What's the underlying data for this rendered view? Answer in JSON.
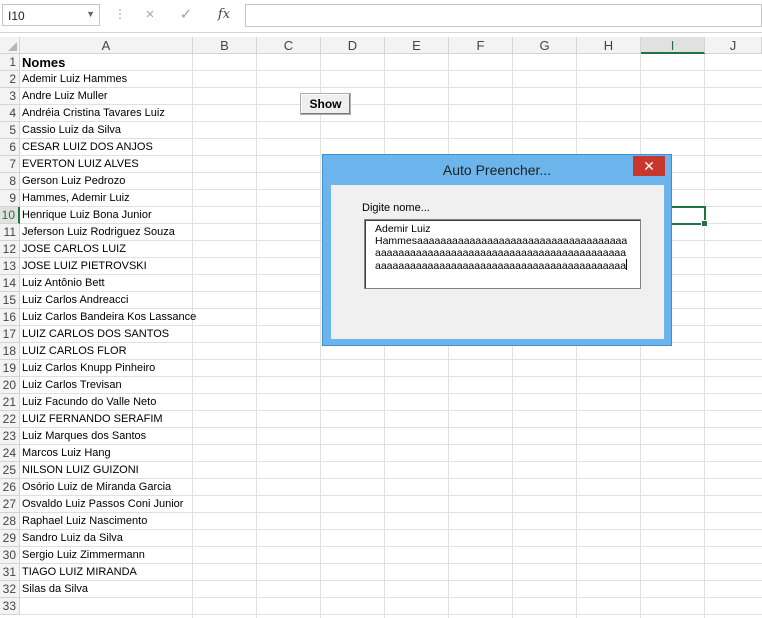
{
  "formula_bar": {
    "name_box": "I10",
    "cancel_icon": "×",
    "enter_icon": "✓",
    "fx_label": "fx",
    "formula": ""
  },
  "columns": [
    "A",
    "B",
    "C",
    "D",
    "E",
    "F",
    "G",
    "H",
    "I",
    "J"
  ],
  "rows": [
    "1",
    "2",
    "3",
    "4",
    "5",
    "6",
    "7",
    "8",
    "9",
    "10",
    "11",
    "12",
    "13",
    "14",
    "15",
    "16",
    "17",
    "18",
    "19",
    "20",
    "21",
    "22",
    "23",
    "24",
    "25",
    "26",
    "27",
    "28",
    "29",
    "30",
    "31",
    "32",
    "33"
  ],
  "column_a": [
    "Nomes",
    "Ademir Luiz Hammes",
    "Andre Luiz Muller",
    "Andréia Cristina Tavares Luiz",
    "Cassio Luiz da Silva",
    "CESAR LUIZ DOS ANJOS",
    "EVERTON LUIZ ALVES",
    "Gerson Luiz Pedrozo",
    "Hammes, Ademir Luiz",
    "Henrique Luiz Bona Junior",
    "Jeferson Luiz Rodriguez Souza",
    "JOSE CARLOS LUIZ",
    "JOSE LUIZ PIETROVSKI",
    "Luiz Antônio Bett",
    "Luiz Carlos Andreacci",
    "Luiz Carlos Bandeira Kos Lassance",
    "LUIZ CARLOS DOS SANTOS",
    "LUIZ CARLOS FLOR",
    "Luiz Carlos Knupp Pinheiro",
    "Luiz Carlos Trevisan",
    "Luiz Facundo do Valle Neto",
    "LUIZ FERNANDO SERAFIM",
    "Luiz Marques dos Santos",
    "Marcos Luiz Hang",
    "NILSON LUIZ GUIZONI",
    "Osório Luiz de Miranda Garcia",
    "Osvaldo Luiz Passos Coni Junior",
    "Raphael Luiz Nascimento",
    "Sandro Luiz da Silva",
    "Sergio Luiz Zimmermann",
    "TIAGO LUIZ MIRANDA",
    "Silas da Silva",
    ""
  ],
  "show_button": "Show",
  "dialog": {
    "title": "Auto Preencher...",
    "close_icon": "✕",
    "label": "Digite nome...",
    "text_lines": [
      "Ademir Luiz",
      "Hammesaaaaaaaaaaaaaaaaaaaaaaaaaaaaaaaaaaaa",
      "aaaaaaaaaaaaaaaaaaaaaaaaaaaaaaaaaaaaaaaaaaa",
      "aaaaaaaaaaaaaaaaaaaaaaaaaaaaaaaaaaaaaaaaaaa"
    ]
  },
  "colors": {
    "excel_green": "#217346",
    "dialog_frame": "#6bb5ec",
    "close_red": "#c8372d"
  }
}
